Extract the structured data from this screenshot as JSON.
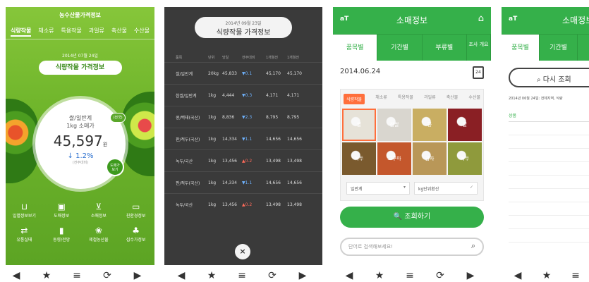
{
  "screen1": {
    "app_title": "농수산물가격정보",
    "categories": [
      "식량작물",
      "채소류",
      "특용작물",
      "과일류",
      "축산물",
      "수산물"
    ],
    "date": "2014년 07월 24일",
    "section_title": "식량작물 가격정보",
    "product_line1": "쌀/일반계",
    "product_line2": "1kg 소매가",
    "price": "45,597",
    "price_unit": "원",
    "change": "1.2%",
    "change_caption": "(전주대비)",
    "tag_label": "(전국)",
    "wholesale_line1": "도매가",
    "wholesale_line2": "보기",
    "menu": [
      {
        "label": "일별정보보기",
        "icon": "basket-icon"
      },
      {
        "label": "도매정보",
        "icon": "truck-icon"
      },
      {
        "label": "소매정보",
        "icon": "cart-icon"
      },
      {
        "label": "친환경정보",
        "icon": "laptop-icon"
      },
      {
        "label": "유통실태",
        "icon": "delivery-icon"
      },
      {
        "label": "동향/전망",
        "icon": "bar-chart-icon"
      },
      {
        "label": "제철농산물",
        "icon": "produce-icon"
      },
      {
        "label": "섭수가정보",
        "icon": "leaf-icon"
      }
    ]
  },
  "screen2": {
    "date": "2014년 09월 23일",
    "title": "식량작물 가격정보",
    "headers": [
      "품목",
      "단위",
      "당일",
      "전주대비",
      "1개월전",
      "1개월전"
    ],
    "rows": [
      {
        "item": "쌀/일반계",
        "unit": "20kg",
        "today": "45,833",
        "change": "▼0.1",
        "dir": "dn",
        "m1": "45,170",
        "m2": "45,170"
      },
      {
        "item": "찹쌀/일반계",
        "unit": "1kg",
        "today": "4,444",
        "change": "▼0.3",
        "dir": "dn",
        "m1": "4,171",
        "m2": "4,171"
      },
      {
        "item": "콩/백태(국산)",
        "unit": "1kg",
        "today": "8,836",
        "change": "▼2.3",
        "dir": "dn",
        "m1": "8,795",
        "m2": "8,795"
      },
      {
        "item": "판/적두(국산)",
        "unit": "1kg",
        "today": "14,334",
        "change": "▼1.1",
        "dir": "dn",
        "m1": "14,656",
        "m2": "14,656"
      },
      {
        "item": "녹두/국산",
        "unit": "1kg",
        "today": "13,456",
        "change": "▲0.2",
        "dir": "up",
        "m1": "13,498",
        "m2": "13,498"
      },
      {
        "item": "판/적두(국산)",
        "unit": "1kg",
        "today": "14,334",
        "change": "▼1.1",
        "dir": "dn",
        "m1": "14,656",
        "m2": "14,656"
      },
      {
        "item": "녹두/국산",
        "unit": "1kg",
        "today": "13,456",
        "change": "▲0.2",
        "dir": "up",
        "m1": "13,498",
        "m2": "13,498"
      }
    ],
    "close_symbol": "×"
  },
  "screen3": {
    "logo": "aT",
    "title": "소매정보",
    "tabs": [
      "품목별",
      "기간별",
      "부류별",
      "조사 개요"
    ],
    "date": "2014.06.24",
    "calendar_day": "24",
    "cat_tabs": [
      "식량작물",
      "채소류",
      "특용작물",
      "과일류",
      "축산물",
      "수산물"
    ],
    "grains": [
      {
        "label": "쌀",
        "color": "#e6e2d8"
      },
      {
        "label": "찹쌀",
        "color": "#d9d6cf"
      },
      {
        "label": "콩",
        "color": "#c9ae62"
      },
      {
        "label": "팥",
        "color": "#8a1f24"
      },
      {
        "label": "녹두",
        "color": "#7a5a2e"
      },
      {
        "label": "고구마",
        "color": "#c4572c"
      },
      {
        "label": "감자",
        "color": "#b99758"
      },
      {
        "label": "녹두",
        "color": "#8f9a3c"
      }
    ],
    "variety": "일반계",
    "unit": "kg단위환산",
    "search_button": "조회하기",
    "search_placeholder": "단어로 검색해보세요!"
  },
  "screen4": {
    "logo": "aT",
    "title": "소매정보",
    "tabs": [
      "품목별",
      "기간별"
    ],
    "research_button": "다시 조회",
    "info": "2014년 06월 24일: 전체지역, 식량",
    "sub_heading": "상품",
    "mini_headers": [
      "구분",
      "",
      "",
      "",
      ""
    ]
  },
  "nav": {
    "back": "◀",
    "favorite": "★",
    "menu": "≡",
    "refresh": "⟳",
    "forward": "▶"
  }
}
